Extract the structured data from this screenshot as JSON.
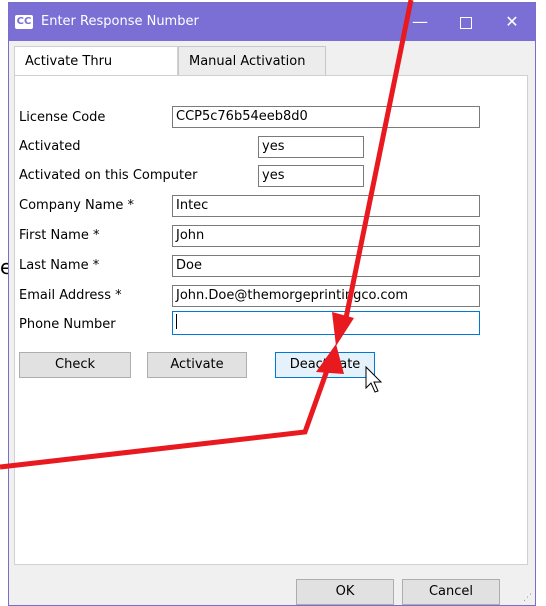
{
  "window": {
    "title": "Enter Response Number",
    "app_icon_text": "CC",
    "minimize_symbol": "—",
    "close_symbol": "✕"
  },
  "background_fragment": "e",
  "tabs": [
    {
      "label": "Activate Thru Internet",
      "selected": true
    },
    {
      "label": "Manual Activation",
      "selected": false
    }
  ],
  "form": {
    "license_code": {
      "label": "License Code",
      "value": "CCP5c76b54eeb8d0"
    },
    "activated": {
      "label": "Activated",
      "value": "yes"
    },
    "activated_this_computer": {
      "label": "Activated on this Computer",
      "value": "yes"
    },
    "company_name": {
      "label": "Company Name *",
      "value": "Intec"
    },
    "first_name": {
      "label": "First Name *",
      "value": "John"
    },
    "last_name": {
      "label": "Last Name *",
      "value": "Doe"
    },
    "email_address": {
      "label": "Email Address *",
      "value": "John.Doe@themorgeprintingco.com"
    },
    "phone_number": {
      "label": "Phone Number",
      "value": ""
    }
  },
  "actions": {
    "check_label": "Check",
    "activate_label": "Activate",
    "deactivate_label": "Deactivate"
  },
  "footer": {
    "ok_label": "OK",
    "cancel_label": "Cancel"
  },
  "colors": {
    "titlebar": "#7b6fd6",
    "annotation_arrow": "#e8191f",
    "focus_border": "#0078d7"
  }
}
